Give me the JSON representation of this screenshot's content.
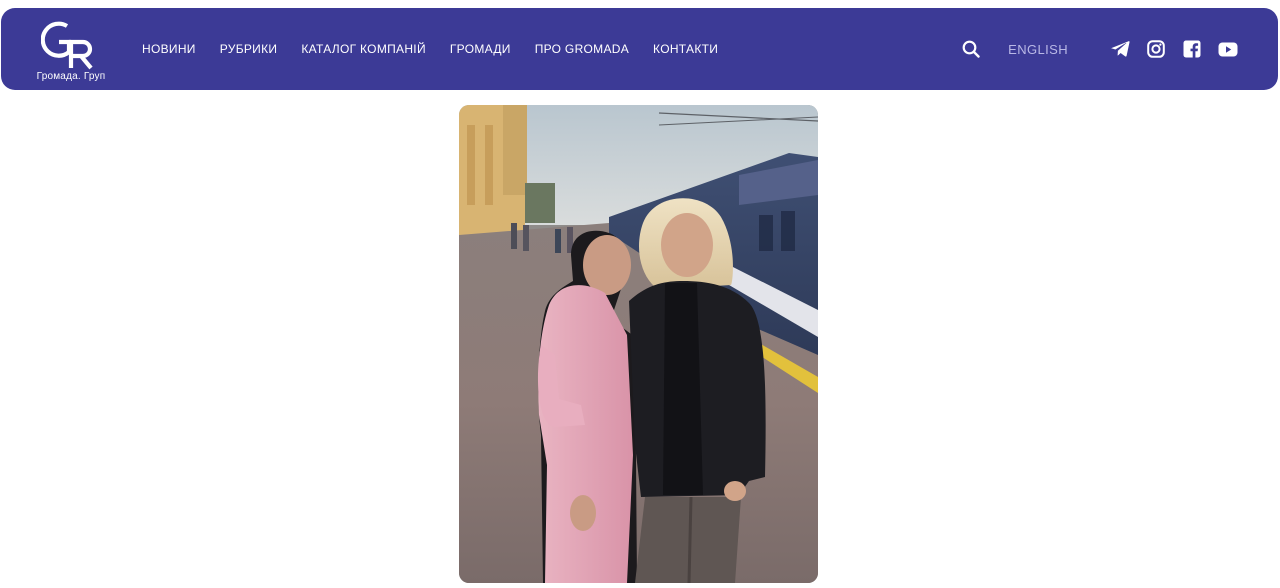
{
  "logo": {
    "caption": "Громада. Груп",
    "mark_letters": "GR"
  },
  "nav": {
    "items": [
      {
        "label": "НОВИНИ"
      },
      {
        "label": "РУБРИКИ"
      },
      {
        "label": "КАТАЛОГ КОМПАНІЙ"
      },
      {
        "label": "ГРОМАДИ"
      },
      {
        "label": "ПРО GROMADA"
      },
      {
        "label": "КОНТАКТИ"
      }
    ],
    "language": "ENGLISH"
  },
  "icons": {
    "search": "search-icon",
    "social": [
      "telegram-icon",
      "instagram-icon",
      "facebook-icon",
      "youtube-icon"
    ]
  },
  "colors": {
    "navbar_bg": "#3c3a96",
    "nav_text": "#ffffff",
    "lang_text": "#b9b8e6",
    "page_bg": "#ffffff"
  },
  "main": {
    "photo": {
      "subject": "two-women-on-train-platform"
    }
  }
}
